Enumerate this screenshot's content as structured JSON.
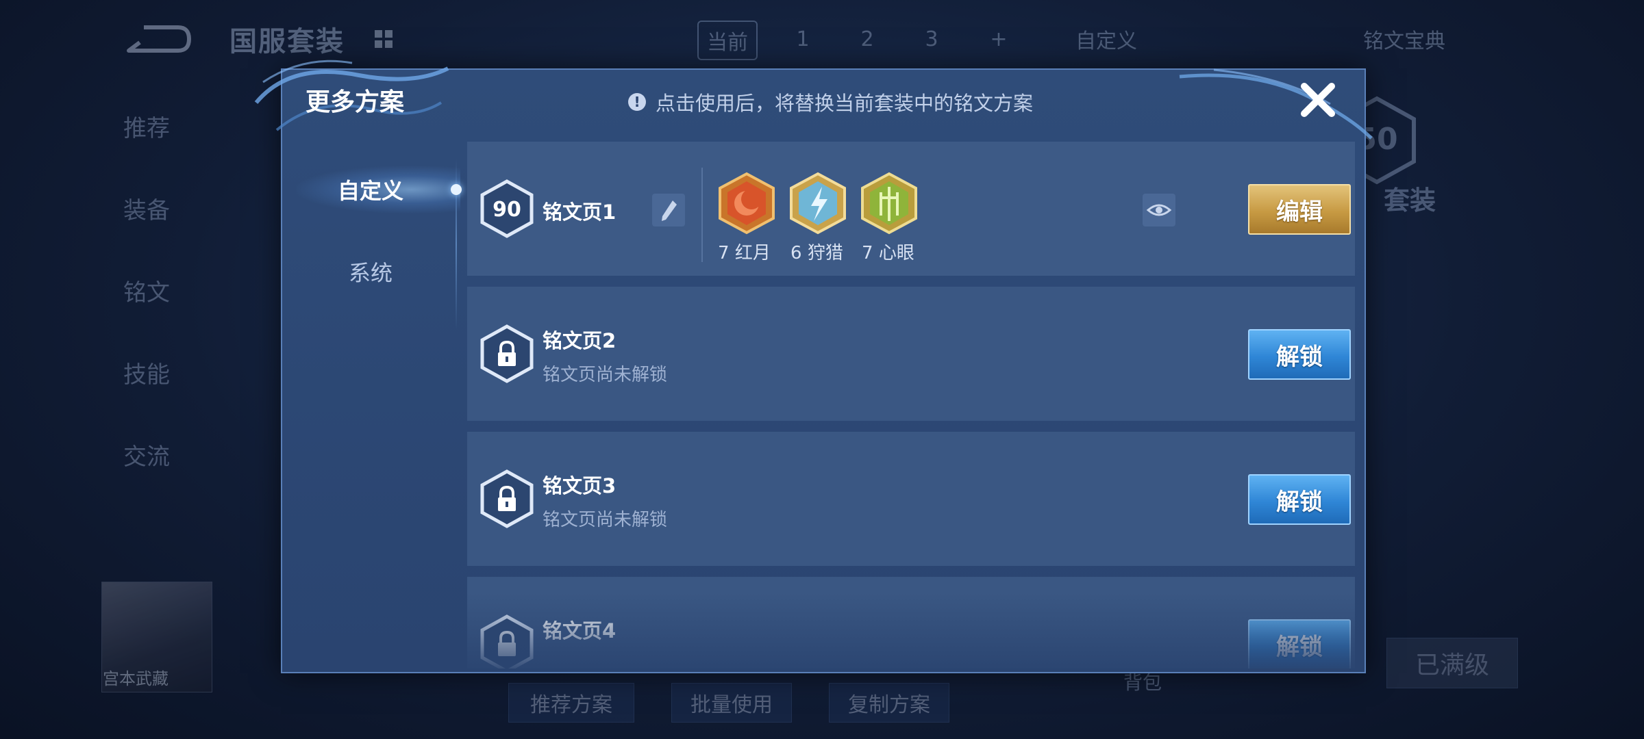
{
  "background": {
    "title": "国服套装",
    "top_tabs": [
      "当前",
      "1",
      "2",
      "3",
      "+"
    ],
    "custom_label": "自定义",
    "codex_label": "铭文宝典",
    "side_menu": [
      "推荐",
      "装备",
      "铭文",
      "技能",
      "交流"
    ],
    "badge_value": "50",
    "suit_label": "套装",
    "hero_name": "宫本武藏",
    "bottom_buttons": [
      "推荐方案",
      "批量使用",
      "复制方案"
    ],
    "bag_label": "背包",
    "maxed_label": "已满级"
  },
  "dialog": {
    "title": "更多方案",
    "notice": "点击使用后，将替换当前套装中的铭文方案",
    "close_icon": "close-icon",
    "tabs": [
      {
        "label": "自定义",
        "active": true
      },
      {
        "label": "系统",
        "active": false
      }
    ],
    "pages": [
      {
        "name": "铭文页1",
        "level": "90",
        "locked": false,
        "runes": [
          {
            "count": "7",
            "name": "红月",
            "color": "#d8542a"
          },
          {
            "count": "6",
            "name": "狩猎",
            "color": "#6fb6d6"
          },
          {
            "count": "7",
            "name": "心眼",
            "color": "#8fb43a"
          }
        ],
        "action": "编辑"
      },
      {
        "name": "铭文页2",
        "subtitle": "铭文页尚未解锁",
        "locked": true,
        "action": "解锁"
      },
      {
        "name": "铭文页3",
        "subtitle": "铭文页尚未解锁",
        "locked": true,
        "action": "解锁"
      },
      {
        "name": "铭文页4",
        "subtitle": "",
        "locked": true,
        "action": "解锁"
      }
    ]
  },
  "colors": {
    "edit_button": "#c79a43",
    "unlock_button": "#2f86d6",
    "panel": "#2f4c79"
  }
}
